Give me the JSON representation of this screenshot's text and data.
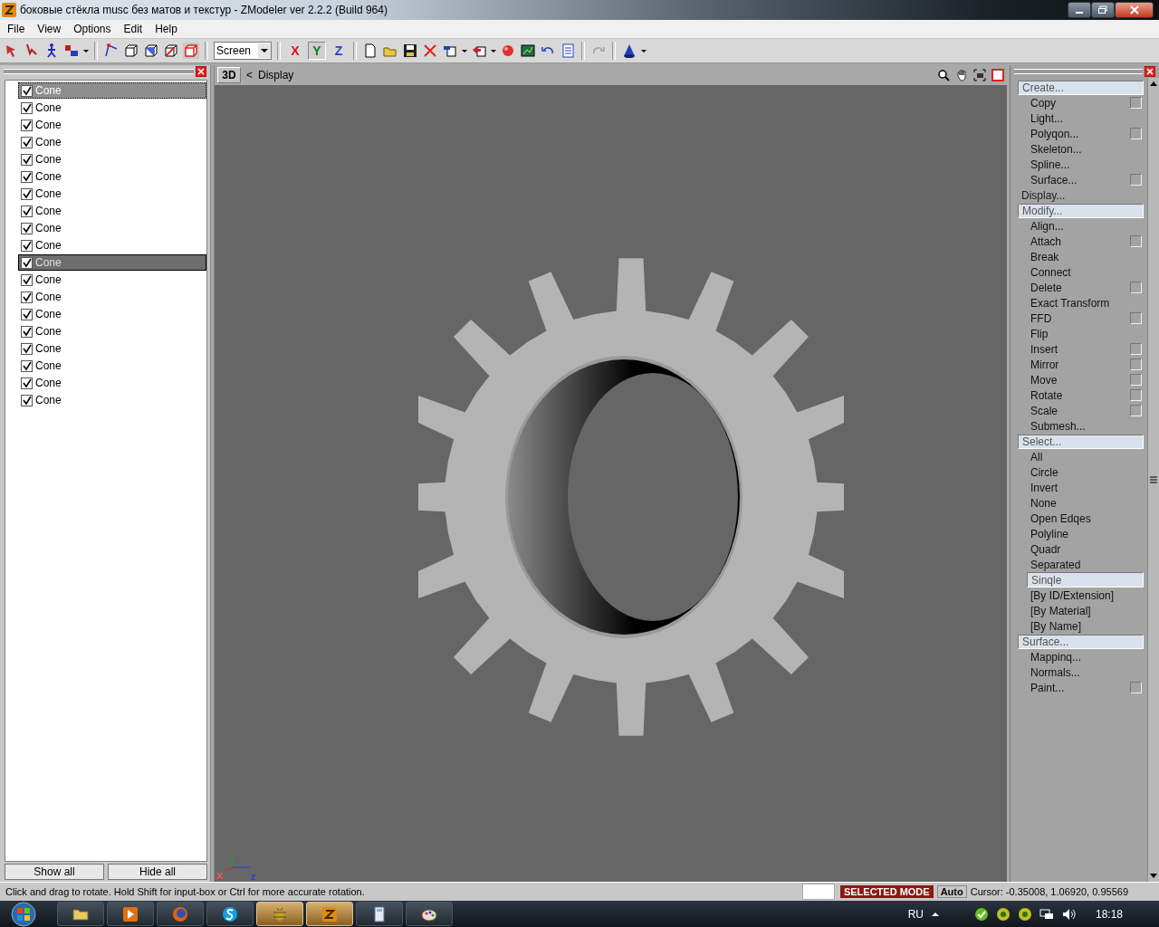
{
  "window": {
    "title": "боковые стёкла musc без матов и текстур - ZModeler ver 2.2.2 (Build 964)"
  },
  "menu": [
    {
      "label": "File"
    },
    {
      "label": "View"
    },
    {
      "label": "Options"
    },
    {
      "label": "Edit"
    },
    {
      "label": "Help"
    }
  ],
  "toolbar": {
    "coord_system": "Screen",
    "axes": [
      {
        "label": "X",
        "color": "#e01010",
        "pressed": false
      },
      {
        "label": "Y",
        "color": "#108010",
        "pressed": true
      },
      {
        "label": "Z",
        "color": "#2040e0",
        "pressed": false
      }
    ]
  },
  "objects": [
    {
      "label": "Cone",
      "checked": true,
      "selected": false,
      "focused": true
    },
    {
      "label": "Cone",
      "checked": true,
      "selected": false,
      "focused": false
    },
    {
      "label": "Cone",
      "checked": true,
      "selected": false,
      "focused": false
    },
    {
      "label": "Cone",
      "checked": true,
      "selected": false,
      "focused": false
    },
    {
      "label": "Cone",
      "checked": true,
      "selected": false,
      "focused": false
    },
    {
      "label": "Cone",
      "checked": true,
      "selected": false,
      "focused": false
    },
    {
      "label": "Cone",
      "checked": true,
      "selected": false,
      "focused": false
    },
    {
      "label": "Cone",
      "checked": true,
      "selected": false,
      "focused": false
    },
    {
      "label": "Cone",
      "checked": true,
      "selected": false,
      "focused": false
    },
    {
      "label": "Cone",
      "checked": true,
      "selected": false,
      "focused": false
    },
    {
      "label": "Cone",
      "checked": true,
      "selected": true,
      "focused": false
    },
    {
      "label": "Cone",
      "checked": true,
      "selected": false,
      "focused": false
    },
    {
      "label": "Cone",
      "checked": true,
      "selected": false,
      "focused": false
    },
    {
      "label": "Cone",
      "checked": true,
      "selected": false,
      "focused": false
    },
    {
      "label": "Cone",
      "checked": true,
      "selected": false,
      "focused": false
    },
    {
      "label": "Cone",
      "checked": true,
      "selected": false,
      "focused": false
    },
    {
      "label": "Cone",
      "checked": true,
      "selected": false,
      "focused": false
    },
    {
      "label": "Cone",
      "checked": true,
      "selected": false,
      "focused": false
    },
    {
      "label": "Cone",
      "checked": true,
      "selected": false,
      "focused": false
    }
  ],
  "object_buttons": [
    {
      "label": "Show all"
    },
    {
      "label": "Hide all"
    }
  ],
  "viewport": {
    "tab": "3D",
    "back": "<",
    "title": "Display",
    "axis_labels": [
      {
        "label": "x",
        "color": "#ff5050"
      },
      {
        "label": "z",
        "color": "#2040e0"
      }
    ]
  },
  "command_panel": [
    {
      "label": "Create...",
      "highlighted": true,
      "children": [
        {
          "label": "Copy",
          "options": true,
          "selected": false
        },
        {
          "label": "Light...",
          "options": false,
          "selected": false
        },
        {
          "label": "Polyqon...",
          "options": true,
          "selected": false
        },
        {
          "label": "Skeleton...",
          "options": false,
          "selected": false
        },
        {
          "label": "Spline...",
          "options": false,
          "selected": false
        },
        {
          "label": "Surface...",
          "options": true,
          "selected": false
        }
      ]
    },
    {
      "label": "Display...",
      "highlighted": false
    },
    {
      "label": "Modify...",
      "highlighted": true,
      "children": [
        {
          "label": "Align...",
          "options": false,
          "selected": false
        },
        {
          "label": "Attach",
          "options": true,
          "selected": false
        },
        {
          "label": "Break",
          "options": false,
          "selected": false
        },
        {
          "label": "Connect",
          "options": false,
          "selected": false
        },
        {
          "label": "Delete",
          "options": true,
          "selected": false
        },
        {
          "label": "Exact Transform",
          "options": false,
          "selected": false
        },
        {
          "label": "FFD",
          "options": true,
          "selected": false
        },
        {
          "label": "Flip",
          "options": false,
          "selected": false
        },
        {
          "label": "Insert",
          "options": true,
          "selected": false
        },
        {
          "label": "Mirror",
          "options": true,
          "selected": false
        },
        {
          "label": "Move",
          "options": true,
          "selected": false
        },
        {
          "label": "Rotate",
          "options": true,
          "selected": false
        },
        {
          "label": "Scale",
          "options": true,
          "selected": false
        },
        {
          "label": "Submesh...",
          "options": false,
          "selected": false
        }
      ]
    },
    {
      "label": "Select...",
      "highlighted": true,
      "children": [
        {
          "label": "All",
          "options": false,
          "selected": false
        },
        {
          "label": "Circle",
          "options": false,
          "selected": false
        },
        {
          "label": "Invert",
          "options": false,
          "selected": false
        },
        {
          "label": "None",
          "options": false,
          "selected": false
        },
        {
          "label": "Open Edqes",
          "options": false,
          "selected": false
        },
        {
          "label": "Polyline",
          "options": false,
          "selected": false
        },
        {
          "label": "Quadr",
          "options": false,
          "selected": false
        },
        {
          "label": "Separated",
          "options": false,
          "selected": false
        },
        {
          "label": "Sinqle",
          "options": false,
          "selected": true
        },
        {
          "label": "[By ID/Extension]",
          "options": false,
          "selected": false
        },
        {
          "label": "[By Material]",
          "options": false,
          "selected": false
        },
        {
          "label": "[By Name]",
          "options": false,
          "selected": false
        }
      ]
    },
    {
      "label": "Surface...",
      "highlighted": true,
      "children": [
        {
          "label": "Mappinq...",
          "options": false,
          "selected": false
        },
        {
          "label": "Normals...",
          "options": false,
          "selected": false
        },
        {
          "label": "Paint...",
          "options": true,
          "selected": false
        }
      ]
    }
  ],
  "status_bar": {
    "message": "Click and drag to rotate. Hold Shift for input-box or Ctrl for more accurate rotation.",
    "mode": "SELECTED MODE",
    "snap": "Auto",
    "cursor": "Cursor: -0.35008, 1.06920, 0.95569"
  },
  "taskbar": {
    "apps": [
      {
        "kind": "folder",
        "active": false
      },
      {
        "kind": "player",
        "active": false
      },
      {
        "kind": "browser",
        "active": false
      },
      {
        "kind": "chat",
        "active": false
      },
      {
        "kind": "bug",
        "active": true
      },
      {
        "kind": "modeler",
        "active": true
      },
      {
        "kind": "calculator",
        "active": false
      },
      {
        "kind": "paint",
        "active": false
      }
    ],
    "language": "RU",
    "time": "18:18"
  }
}
